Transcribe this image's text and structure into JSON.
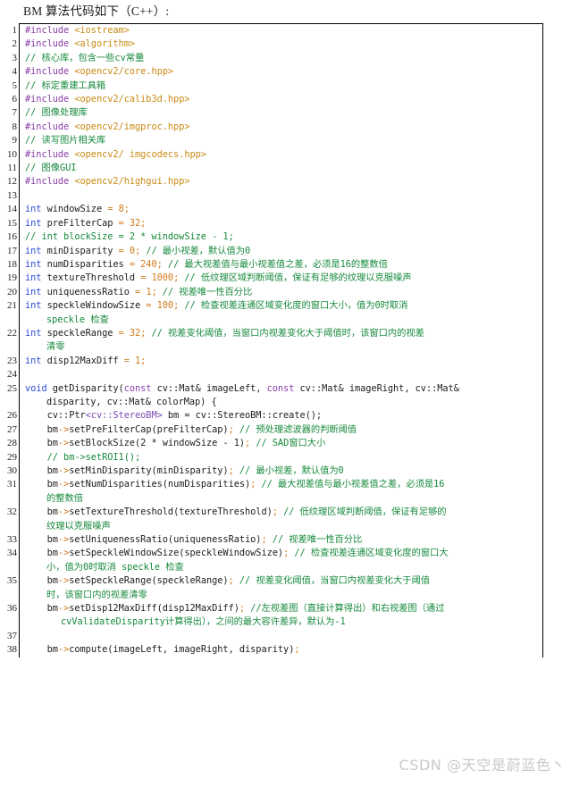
{
  "document": {
    "heading": "BM 算法代码如下（C++）:",
    "language": "C++",
    "watermark": "CSDN @天空是蔚蓝色丶",
    "colors": {
      "preprocessor": "#8a3ea8",
      "include_target": "#c98a14",
      "comment": "#178a3c",
      "keyword": "#2a4ad7",
      "keyword_alt": "#8a3ea8",
      "operator": "#d07b1a",
      "number": "#d07b1a",
      "type": "#7a4bb5",
      "plain": "#1d1d1d",
      "border": "#000000",
      "watermark": "#c9c9c9",
      "background": "#ffffff"
    }
  },
  "code": {
    "lines": [
      {
        "n": "1",
        "wrapped": false,
        "parts": [
          {
            "c": "t-pre",
            "t": "#include"
          },
          {
            "c": "t-plain",
            "t": " "
          },
          {
            "c": "t-inc",
            "t": "<iostream>"
          }
        ]
      },
      {
        "n": "2",
        "wrapped": false,
        "parts": [
          {
            "c": "t-pre",
            "t": "#include"
          },
          {
            "c": "t-plain",
            "t": " "
          },
          {
            "c": "t-inc",
            "t": "<algorithm>"
          }
        ]
      },
      {
        "n": "3",
        "wrapped": false,
        "parts": [
          {
            "c": "t-cmt",
            "t": "// 核心库，包含一些cv常量"
          }
        ]
      },
      {
        "n": "4",
        "wrapped": false,
        "parts": [
          {
            "c": "t-pre",
            "t": "#include"
          },
          {
            "c": "t-plain",
            "t": " "
          },
          {
            "c": "t-inc",
            "t": "<opencv2/core.hpp>"
          }
        ]
      },
      {
        "n": "5",
        "wrapped": false,
        "parts": [
          {
            "c": "t-cmt",
            "t": "// 标定重建工具箱"
          }
        ]
      },
      {
        "n": "6",
        "wrapped": false,
        "parts": [
          {
            "c": "t-pre",
            "t": "#include"
          },
          {
            "c": "t-plain",
            "t": " "
          },
          {
            "c": "t-inc",
            "t": "<opencv2/calib3d.hpp>"
          }
        ]
      },
      {
        "n": "7",
        "wrapped": false,
        "parts": [
          {
            "c": "t-cmt",
            "t": "// 图像处理库"
          }
        ]
      },
      {
        "n": "8",
        "wrapped": false,
        "parts": [
          {
            "c": "t-pre",
            "t": "#include"
          },
          {
            "c": "t-plain",
            "t": " "
          },
          {
            "c": "t-inc",
            "t": "<opencv2/imgproc.hpp>"
          }
        ]
      },
      {
        "n": "9",
        "wrapped": false,
        "parts": [
          {
            "c": "t-cmt",
            "t": "// 读写图片相关库"
          }
        ]
      },
      {
        "n": "10",
        "wrapped": false,
        "parts": [
          {
            "c": "t-pre",
            "t": "#include"
          },
          {
            "c": "t-plain",
            "t": " "
          },
          {
            "c": "t-inc",
            "t": "<opencv2/ imgcodecs.hpp>"
          }
        ]
      },
      {
        "n": "11",
        "wrapped": false,
        "parts": [
          {
            "c": "t-cmt",
            "t": "// 图像GUI"
          }
        ]
      },
      {
        "n": "12",
        "wrapped": false,
        "parts": [
          {
            "c": "t-pre",
            "t": "#include"
          },
          {
            "c": "t-plain",
            "t": " "
          },
          {
            "c": "t-inc",
            "t": "<opencv2/highgui.hpp>"
          }
        ]
      },
      {
        "n": "13",
        "wrapped": false,
        "parts": []
      },
      {
        "n": "14",
        "wrapped": false,
        "parts": [
          {
            "c": "t-kw",
            "t": "int"
          },
          {
            "c": "t-plain",
            "t": " windowSize "
          },
          {
            "c": "t-op",
            "t": "="
          },
          {
            "c": "t-plain",
            "t": " "
          },
          {
            "c": "t-num",
            "t": "8"
          },
          {
            "c": "t-op",
            "t": ";"
          }
        ]
      },
      {
        "n": "15",
        "wrapped": false,
        "parts": [
          {
            "c": "t-kw",
            "t": "int"
          },
          {
            "c": "t-plain",
            "t": " preFilterCap "
          },
          {
            "c": "t-op",
            "t": "="
          },
          {
            "c": "t-plain",
            "t": " "
          },
          {
            "c": "t-num",
            "t": "32"
          },
          {
            "c": "t-op",
            "t": ";"
          }
        ]
      },
      {
        "n": "16",
        "wrapped": false,
        "parts": [
          {
            "c": "t-cmt",
            "t": "// int blockSize = 2 * windowSize - 1;"
          }
        ]
      },
      {
        "n": "17",
        "wrapped": false,
        "parts": [
          {
            "c": "t-kw",
            "t": "int"
          },
          {
            "c": "t-plain",
            "t": " minDisparity "
          },
          {
            "c": "t-op",
            "t": "="
          },
          {
            "c": "t-plain",
            "t": " "
          },
          {
            "c": "t-num",
            "t": "0"
          },
          {
            "c": "t-op",
            "t": ";"
          },
          {
            "c": "t-plain",
            "t": " "
          },
          {
            "c": "t-cmt",
            "t": "// 最小视差，默认值为0"
          }
        ]
      },
      {
        "n": "18",
        "wrapped": false,
        "parts": [
          {
            "c": "t-kw",
            "t": "int"
          },
          {
            "c": "t-plain",
            "t": " numDisparities "
          },
          {
            "c": "t-op",
            "t": "="
          },
          {
            "c": "t-plain",
            "t": " "
          },
          {
            "c": "t-num",
            "t": "240"
          },
          {
            "c": "t-op",
            "t": ";"
          },
          {
            "c": "t-plain",
            "t": " "
          },
          {
            "c": "t-cmt",
            "t": "// 最大视差值与最小视差值之差，必须是16的整数倍"
          }
        ]
      },
      {
        "n": "19",
        "wrapped": false,
        "parts": [
          {
            "c": "t-kw",
            "t": "int"
          },
          {
            "c": "t-plain",
            "t": " textureThreshold "
          },
          {
            "c": "t-op",
            "t": "="
          },
          {
            "c": "t-plain",
            "t": " "
          },
          {
            "c": "t-num",
            "t": "1000"
          },
          {
            "c": "t-op",
            "t": ";"
          },
          {
            "c": "t-plain",
            "t": " "
          },
          {
            "c": "t-cmt",
            "t": "// 低纹理区域判断阈值，保证有足够的纹理以克服噪声"
          }
        ]
      },
      {
        "n": "20",
        "wrapped": false,
        "parts": [
          {
            "c": "t-kw",
            "t": "int"
          },
          {
            "c": "t-plain",
            "t": " uniquenessRatio "
          },
          {
            "c": "t-op",
            "t": "="
          },
          {
            "c": "t-plain",
            "t": " "
          },
          {
            "c": "t-num",
            "t": "1"
          },
          {
            "c": "t-op",
            "t": ";"
          },
          {
            "c": "t-plain",
            "t": " "
          },
          {
            "c": "t-cmt",
            "t": "// 视差唯一性百分比"
          }
        ]
      },
      {
        "n": "21",
        "wrapped": true,
        "parts": [
          {
            "c": "t-kw",
            "t": "int"
          },
          {
            "c": "t-plain",
            "t": " speckleWindowSize "
          },
          {
            "c": "t-op",
            "t": "="
          },
          {
            "c": "t-plain",
            "t": " "
          },
          {
            "c": "t-num",
            "t": "100"
          },
          {
            "c": "t-op",
            "t": ";"
          },
          {
            "c": "t-plain",
            "t": " "
          },
          {
            "c": "t-cmt",
            "t": "// 检查视差连通区域变化度的窗口大小，值为0时取消"
          }
        ],
        "cont": [
          {
            "c": "t-cmt",
            "t": "speckle 检查"
          }
        ]
      },
      {
        "n": "22",
        "wrapped": true,
        "parts": [
          {
            "c": "t-kw",
            "t": "int"
          },
          {
            "c": "t-plain",
            "t": " speckleRange "
          },
          {
            "c": "t-op",
            "t": "="
          },
          {
            "c": "t-plain",
            "t": " "
          },
          {
            "c": "t-num",
            "t": "32"
          },
          {
            "c": "t-op",
            "t": ";"
          },
          {
            "c": "t-plain",
            "t": " "
          },
          {
            "c": "t-cmt",
            "t": "// 视差变化阈值，当窗口内视差变化大于阈值时，该窗口内的视差"
          }
        ],
        "cont": [
          {
            "c": "t-cmt",
            "t": "清零"
          }
        ]
      },
      {
        "n": "23",
        "wrapped": false,
        "parts": [
          {
            "c": "t-kw",
            "t": "int"
          },
          {
            "c": "t-plain",
            "t": " disp12MaxDiff "
          },
          {
            "c": "t-op",
            "t": "="
          },
          {
            "c": "t-plain",
            "t": " "
          },
          {
            "c": "t-num",
            "t": "1"
          },
          {
            "c": "t-op",
            "t": ";"
          }
        ]
      },
      {
        "n": "24",
        "wrapped": false,
        "parts": []
      },
      {
        "n": "25",
        "wrapped": true,
        "parts": [
          {
            "c": "t-kw",
            "t": "void"
          },
          {
            "c": "t-plain",
            "t": " getDisparity("
          },
          {
            "c": "t-kw2",
            "t": "const"
          },
          {
            "c": "t-plain",
            "t": " cv::Mat& imageLeft, "
          },
          {
            "c": "t-kw2",
            "t": "const"
          },
          {
            "c": "t-plain",
            "t": " cv::Mat& imageRight, cv::Mat&"
          }
        ],
        "cont": [
          {
            "c": "t-plain",
            "t": "disparity, cv::Mat& colorMap) {"
          }
        ]
      },
      {
        "n": "26",
        "wrapped": false,
        "parts": [
          {
            "c": "t-plain",
            "t": "    cv::Ptr"
          },
          {
            "c": "t-type",
            "t": "<cv::StereoBM>"
          },
          {
            "c": "t-plain",
            "t": " bm = cv::StereoBM::create();"
          }
        ]
      },
      {
        "n": "27",
        "wrapped": false,
        "parts": [
          {
            "c": "t-plain",
            "t": "    bm"
          },
          {
            "c": "t-op",
            "t": "->"
          },
          {
            "c": "t-plain",
            "t": "setPreFilterCap(preFilterCap)"
          },
          {
            "c": "t-op",
            "t": ";"
          },
          {
            "c": "t-plain",
            "t": " "
          },
          {
            "c": "t-cmt",
            "t": "// 预处理滤波器的判断阈值"
          }
        ]
      },
      {
        "n": "28",
        "wrapped": false,
        "parts": [
          {
            "c": "t-plain",
            "t": "    bm"
          },
          {
            "c": "t-op",
            "t": "->"
          },
          {
            "c": "t-plain",
            "t": "setBlockSize(2 * windowSize - 1)"
          },
          {
            "c": "t-op",
            "t": ";"
          },
          {
            "c": "t-plain",
            "t": " "
          },
          {
            "c": "t-cmt",
            "t": "// SAD窗口大小"
          }
        ]
      },
      {
        "n": "29",
        "wrapped": false,
        "parts": [
          {
            "c": "t-plain",
            "t": "    "
          },
          {
            "c": "t-cmt",
            "t": "// bm->setROI1();"
          }
        ]
      },
      {
        "n": "30",
        "wrapped": false,
        "parts": [
          {
            "c": "t-plain",
            "t": "    bm"
          },
          {
            "c": "t-op",
            "t": "->"
          },
          {
            "c": "t-plain",
            "t": "setMinDisparity(minDisparity)"
          },
          {
            "c": "t-op",
            "t": ";"
          },
          {
            "c": "t-plain",
            "t": " "
          },
          {
            "c": "t-cmt",
            "t": "// 最小视差，默认值为0"
          }
        ]
      },
      {
        "n": "31",
        "wrapped": true,
        "parts": [
          {
            "c": "t-plain",
            "t": "    bm"
          },
          {
            "c": "t-op",
            "t": "->"
          },
          {
            "c": "t-plain",
            "t": "setNumDisparities(numDisparities)"
          },
          {
            "c": "t-op",
            "t": ";"
          },
          {
            "c": "t-plain",
            "t": " "
          },
          {
            "c": "t-cmt",
            "t": "// 最大视差值与最小视差值之差，必须是16"
          }
        ],
        "cont": [
          {
            "c": "t-cmt",
            "t": "的整数倍"
          }
        ]
      },
      {
        "n": "32",
        "wrapped": true,
        "parts": [
          {
            "c": "t-plain",
            "t": "    bm"
          },
          {
            "c": "t-op",
            "t": "->"
          },
          {
            "c": "t-plain",
            "t": "setTextureThreshold(textureThreshold)"
          },
          {
            "c": "t-op",
            "t": ";"
          },
          {
            "c": "t-plain",
            "t": " "
          },
          {
            "c": "t-cmt",
            "t": "// 低纹理区域判断阈值，保证有足够的"
          }
        ],
        "cont": [
          {
            "c": "t-cmt",
            "t": "纹理以克服噪声"
          }
        ]
      },
      {
        "n": "33",
        "wrapped": false,
        "parts": [
          {
            "c": "t-plain",
            "t": "    bm"
          },
          {
            "c": "t-op",
            "t": "->"
          },
          {
            "c": "t-plain",
            "t": "setUniquenessRatio(uniquenessRatio)"
          },
          {
            "c": "t-op",
            "t": ";"
          },
          {
            "c": "t-plain",
            "t": " "
          },
          {
            "c": "t-cmt",
            "t": "// 视差唯一性百分比"
          }
        ]
      },
      {
        "n": "34",
        "wrapped": true,
        "parts": [
          {
            "c": "t-plain",
            "t": "    bm"
          },
          {
            "c": "t-op",
            "t": "->"
          },
          {
            "c": "t-plain",
            "t": "setSpeckleWindowSize(speckleWindowSize)"
          },
          {
            "c": "t-op",
            "t": ";"
          },
          {
            "c": "t-plain",
            "t": " "
          },
          {
            "c": "t-cmt",
            "t": "// 检查视差连通区域变化度的窗口大"
          }
        ],
        "cont": [
          {
            "c": "t-cmt",
            "t": "小，值为0时取消 speckle 检查"
          }
        ]
      },
      {
        "n": "35",
        "wrapped": true,
        "parts": [
          {
            "c": "t-plain",
            "t": "    bm"
          },
          {
            "c": "t-op",
            "t": "->"
          },
          {
            "c": "t-plain",
            "t": "setSpeckleRange(speckleRange)"
          },
          {
            "c": "t-op",
            "t": ";"
          },
          {
            "c": "t-plain",
            "t": " "
          },
          {
            "c": "t-cmt",
            "t": "// 视差变化阈值，当窗口内视差变化大于阈值"
          }
        ],
        "cont": [
          {
            "c": "t-cmt",
            "t": "时，该窗口内的视差清零"
          }
        ]
      },
      {
        "n": "36",
        "wrapped": true,
        "parts": [
          {
            "c": "t-plain",
            "t": "    bm"
          },
          {
            "c": "t-op",
            "t": "->"
          },
          {
            "c": "t-plain",
            "t": "setDisp12MaxDiff(disp12MaxDiff)"
          },
          {
            "c": "t-op",
            "t": ";"
          },
          {
            "c": "t-plain",
            "t": " "
          },
          {
            "c": "t-cmt",
            "t": "//左视差图（直接计算得出）和右视差图（通过"
          }
        ],
        "cont": [
          {
            "c": "t-cmt",
            "t": "cvValidateDisparity计算得出），之间的最大容许差异，默认为-1"
          }
        ]
      },
      {
        "n": "37",
        "wrapped": false,
        "parts": []
      },
      {
        "n": "38",
        "wrapped": false,
        "parts": [
          {
            "c": "t-plain",
            "t": "    bm"
          },
          {
            "c": "t-op",
            "t": "->"
          },
          {
            "c": "t-plain",
            "t": "compute(imageLeft, imageRight, disparity)"
          },
          {
            "c": "t-op",
            "t": ";"
          }
        ]
      }
    ]
  }
}
